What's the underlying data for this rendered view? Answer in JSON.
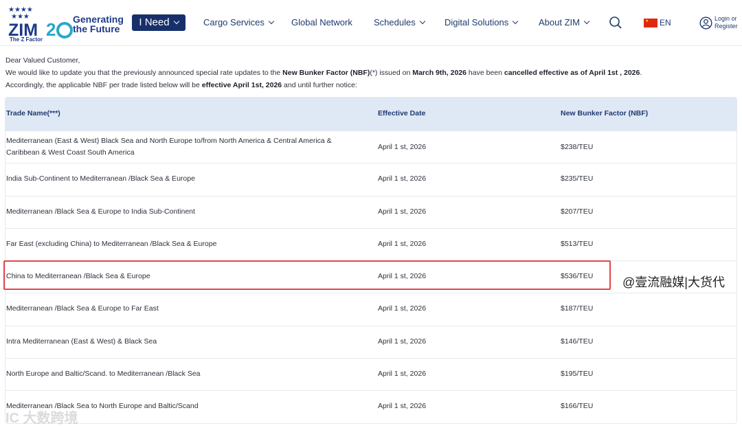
{
  "brand": {
    "logo_text": "ZIM",
    "logo_number": "20",
    "tagline_1": "Generating",
    "tagline_2": "the Future",
    "sub": "The Z Factor",
    "colors": {
      "navy": "#17306b",
      "blue": "#1d3a8a",
      "teal": "#2aa7c9",
      "highlight": "#e2454a"
    }
  },
  "nav": {
    "ineed": "I Need",
    "items": [
      {
        "label": "Cargo Services",
        "dropdown": true
      },
      {
        "label": "Global Network",
        "dropdown": false
      },
      {
        "label": "Schedules",
        "dropdown": true
      },
      {
        "label": "Digital Solutions",
        "dropdown": true
      },
      {
        "label": "About ZIM",
        "dropdown": true
      }
    ],
    "language": "EN",
    "login": "Login or",
    "register": "Register",
    "icons": [
      "search-icon",
      "china-flag-icon",
      "user-icon",
      "chevron-down-icon"
    ]
  },
  "intro": {
    "greeting": "Dear Valued Customer,",
    "line2_a": "We would like to update you that the previously announced special rate updates to the ",
    "line2_b": "New Bunker Factor (NBF)",
    "line2_c": "(*) issued on ",
    "line2_d": "March 9th, 2026",
    "line2_e": " have been ",
    "line2_f": "cancelled effective as of April 1st , 2026",
    "line2_g": ".",
    "line3_a": "Accordingly, the applicable NBF per trade listed below will be ",
    "line3_b": "effective April 1st, 2026",
    "line3_c": " and until further notice:"
  },
  "table": {
    "headers": [
      "Trade Name(***)",
      "Effective Date",
      "New Bunker Factor (NBF)"
    ],
    "rows": [
      {
        "trade": "Mediterranean (East & West) Black Sea and North Europe to/from North America & Central America & Caribbean & West Coast South America",
        "date": "April 1 st, 2026",
        "nbf": "$238/TEU"
      },
      {
        "trade": "India Sub-Continent to Mediterranean /Black Sea & Europe",
        "date": "April 1 st, 2026",
        "nbf": "$235/TEU"
      },
      {
        "trade": "Mediterranean /Black Sea & Europe to India Sub-Continent",
        "date": "April 1 st, 2026",
        "nbf": "$207/TEU"
      },
      {
        "trade": "Far East (excluding China) to Mediterranean /Black Sea & Europe",
        "date": "April 1 st, 2026",
        "nbf": "$513/TEU"
      },
      {
        "trade": "China to Mediterranean /Black Sea & Europe",
        "date": "April 1 st, 2026",
        "nbf": "$536/TEU"
      },
      {
        "trade": "Mediterranean /Black Sea & Europe to Far East",
        "date": "April 1 st, 2026",
        "nbf": "$187/TEU"
      },
      {
        "trade": "Intra Mediterranean (East & West) & Black Sea",
        "date": "April 1 st, 2026",
        "nbf": "$146/TEU"
      },
      {
        "trade": "North Europe and Baltic/Scand. to Mediterranean /Black Sea",
        "date": "April 1 st, 2026",
        "nbf": "$195/TEU"
      },
      {
        "trade": "Mediterranean /Black Sea to North Europe and Baltic/Scand",
        "date": "April 1 st, 2026",
        "nbf": "$166/TEU"
      }
    ]
  },
  "watermarks": {
    "right": "@壹流融媒|大货代",
    "left": "IC 大数跨境"
  }
}
